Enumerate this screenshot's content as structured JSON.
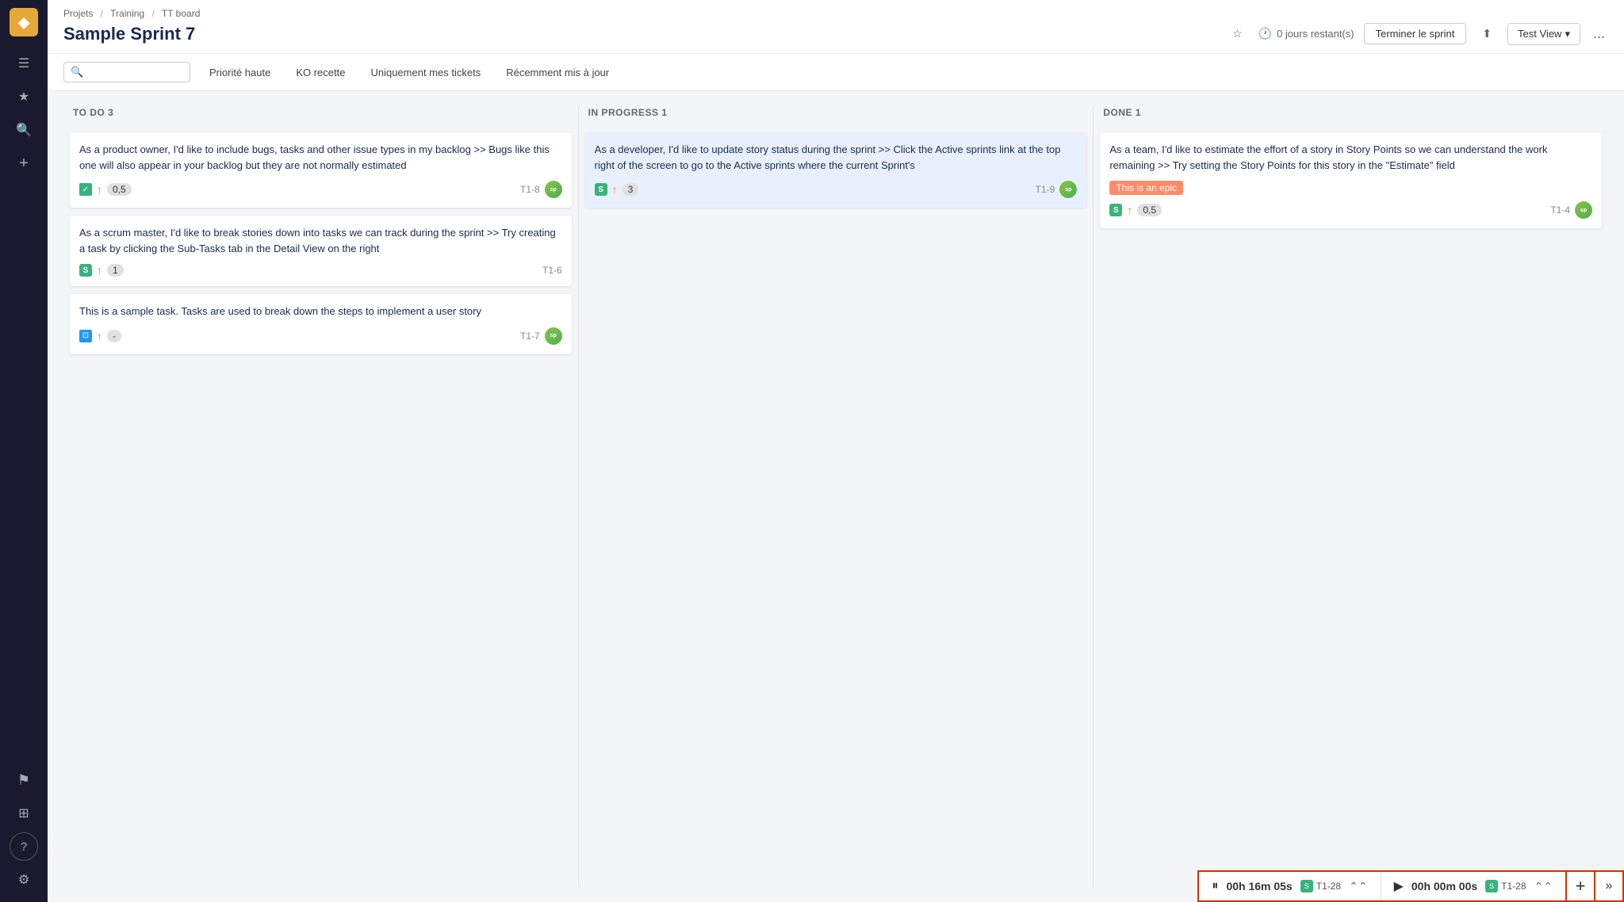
{
  "sidebar": {
    "logo_char": "◆",
    "items": [
      {
        "id": "hamburger",
        "icon": "☰",
        "label": "Menu"
      },
      {
        "id": "star",
        "icon": "★",
        "label": "Favorites"
      },
      {
        "id": "search",
        "icon": "🔍",
        "label": "Search"
      },
      {
        "id": "add",
        "icon": "+",
        "label": "Create"
      }
    ],
    "bottom_items": [
      {
        "id": "flag",
        "icon": "⚑",
        "label": "Reports"
      },
      {
        "id": "grid",
        "icon": "⊞",
        "label": "Apps"
      },
      {
        "id": "help",
        "icon": "?",
        "label": "Help"
      },
      {
        "id": "settings",
        "icon": "⚙",
        "label": "Settings"
      }
    ]
  },
  "breadcrumb": {
    "items": [
      "Projets",
      "Training",
      "TT board"
    ],
    "separators": [
      "/",
      "/"
    ]
  },
  "header": {
    "title": "Sample Sprint 7",
    "time_remaining": "0 jours restant(s)",
    "end_sprint_label": "Terminer le sprint",
    "view_label": "Test View",
    "share_icon": "share",
    "more_icon": "..."
  },
  "filterbar": {
    "search_placeholder": "",
    "filters": [
      "Priorité haute",
      "KO recette",
      "Uniquement mes tickets",
      "Récemment mis à jour"
    ]
  },
  "columns": [
    {
      "id": "todo",
      "header": "TO DO  3",
      "cards": [
        {
          "id": "c1",
          "text": "As a product owner, I'd like to include bugs, tasks and other issue types in my backlog >> Bugs like this one will also appear in your backlog but they are not normally estimated",
          "icon_type": "check",
          "priority": "up",
          "estimate": "0,5",
          "ticket": "T1-8",
          "has_avatar": true
        },
        {
          "id": "c2",
          "text": "As a scrum master, I'd like to break stories down into tasks we can track during the sprint >> Try creating a task by clicking the Sub-Tasks tab in the Detail View on the right",
          "icon_type": "story",
          "priority": "up",
          "estimate": "1",
          "ticket": "T1-6",
          "has_avatar": false
        },
        {
          "id": "c3",
          "text": "This is a sample task. Tasks are used to break down the steps to implement a user story",
          "icon_type": "task",
          "priority": "up",
          "estimate": "-",
          "ticket": "T1-7",
          "has_avatar": true
        }
      ]
    },
    {
      "id": "inprogress",
      "header": "IN PROGRESS  1",
      "cards": [
        {
          "id": "c4",
          "text": "As a developer, I'd like to update story status during the sprint >> Click the Active sprints link at the top right of the screen to go to the Active sprints where the current Sprint's",
          "icon_type": "story",
          "priority": "up",
          "estimate": "3",
          "ticket": "T1-9",
          "has_avatar": true,
          "in_progress": true
        }
      ]
    },
    {
      "id": "done",
      "header": "DONE  1",
      "cards": [
        {
          "id": "c5",
          "text": "As a team, I'd like to estimate the effort of a story in Story Points so we can understand the work remaining >> Try setting the Story Points for this story in the \"Estimate\" field",
          "epic_label": "This is an epic",
          "icon_type": "story",
          "priority": "up",
          "estimate": "0,5",
          "ticket": "T1-4",
          "has_avatar": true
        }
      ]
    }
  ],
  "timer": {
    "panel1": {
      "state": "pause",
      "time": "00h 16m 05s",
      "ticket": "T1-28"
    },
    "panel2": {
      "state": "play",
      "time": "00h 00m 00s",
      "ticket": "T1-28"
    },
    "add_label": "+",
    "more_label": "»"
  }
}
